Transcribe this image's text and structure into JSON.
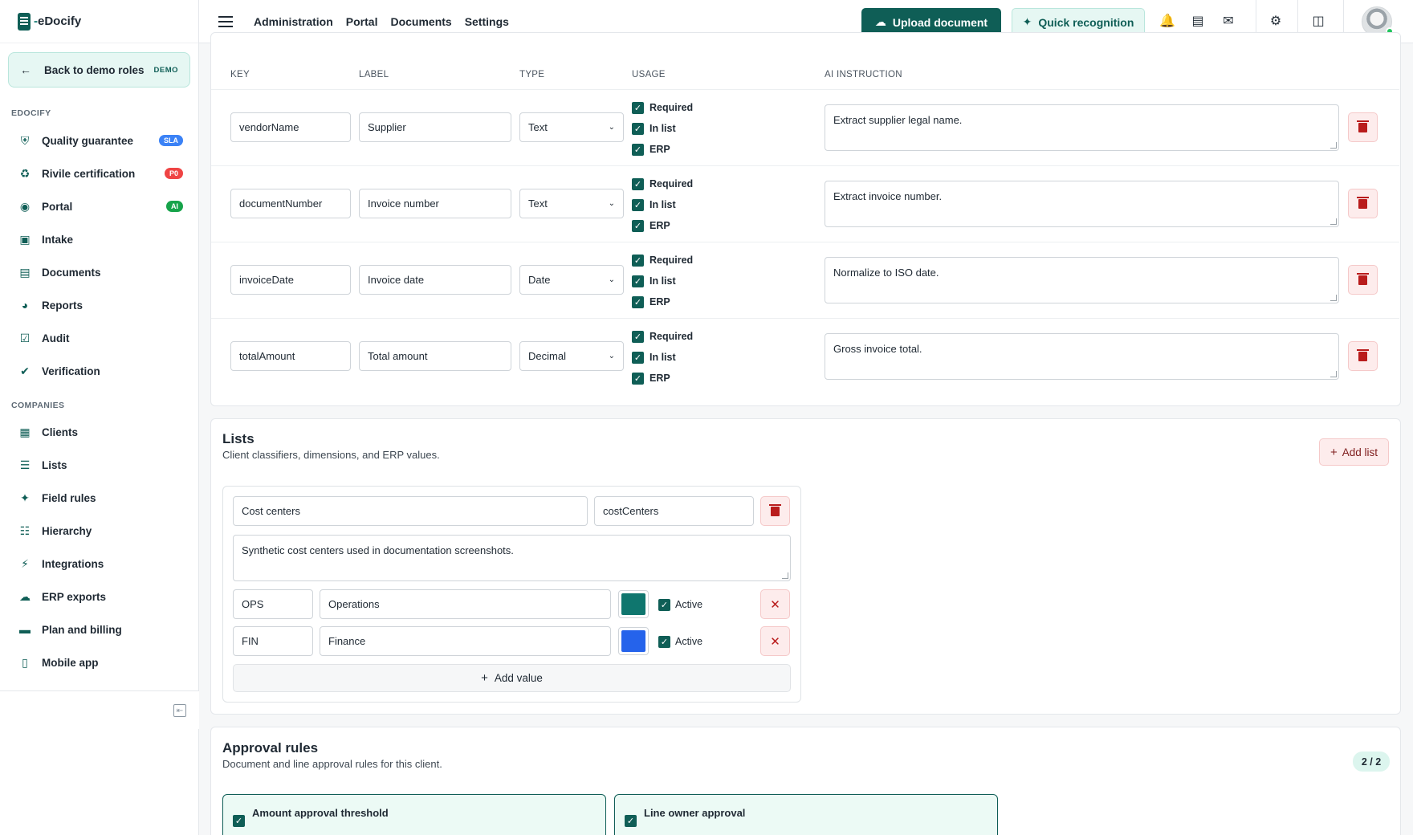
{
  "brand": {
    "prefix": "-",
    "name": "eDocify"
  },
  "back": {
    "label": "Back to demo roles",
    "tag": "DEMO"
  },
  "sidebar": {
    "section1": "EDOCIFY",
    "section2": "COMPANIES",
    "items": [
      {
        "label": "Quality guarantee",
        "badge": "SLA",
        "badge_color": "#3b82f6"
      },
      {
        "label": "Rivile certification",
        "badge": "P0",
        "badge_color": "#ef4444"
      },
      {
        "label": "Portal",
        "badge": "AI",
        "badge_color": "#16a34a"
      },
      {
        "label": "Intake"
      },
      {
        "label": "Documents"
      },
      {
        "label": "Reports"
      },
      {
        "label": "Audit"
      },
      {
        "label": "Verification"
      },
      {
        "label": "Clients"
      },
      {
        "label": "Lists"
      },
      {
        "label": "Field rules"
      },
      {
        "label": "Hierarchy"
      },
      {
        "label": "Integrations"
      },
      {
        "label": "ERP exports"
      },
      {
        "label": "Plan and billing"
      },
      {
        "label": "Mobile app"
      }
    ]
  },
  "topbar": {
    "nav": [
      "Administration",
      "Portal",
      "Documents",
      "Settings"
    ],
    "upload_label": "Upload document",
    "quick_label": "Quick recognition"
  },
  "fields": {
    "headers": {
      "key": "KEY",
      "label": "LABEL",
      "type": "TYPE",
      "usage": "USAGE",
      "ai": "AI INSTRUCTION"
    },
    "usage_labels": {
      "required": "Required",
      "in_list": "In list",
      "erp": "ERP"
    },
    "rows": [
      {
        "key": "vendorName",
        "label": "Supplier",
        "type": "Text",
        "instruction": "Extract supplier legal name."
      },
      {
        "key": "documentNumber",
        "label": "Invoice number",
        "type": "Text",
        "instruction": "Extract invoice number."
      },
      {
        "key": "invoiceDate",
        "label": "Invoice date",
        "type": "Date",
        "instruction": "Normalize to ISO date."
      },
      {
        "key": "totalAmount",
        "label": "Total amount",
        "type": "Decimal",
        "instruction": "Gross invoice total."
      }
    ]
  },
  "lists": {
    "title": "Lists",
    "subtitle": "Client classifiers, dimensions, and ERP values.",
    "add_label": "Add list",
    "list_name": "Cost centers",
    "list_key": "costCenters",
    "description": "Synthetic cost centers used in documentation screenshots.",
    "active_label": "Active",
    "values": [
      {
        "code": "OPS",
        "name": "Operations",
        "color": "#0f766e"
      },
      {
        "code": "FIN",
        "name": "Finance",
        "color": "#2563eb"
      }
    ],
    "add_value_label": "Add value"
  },
  "approval": {
    "title": "Approval rules",
    "subtitle": "Document and line approval rules for this client.",
    "count": "2 / 2",
    "rules": [
      "Amount approval threshold",
      "Line owner approval"
    ]
  }
}
